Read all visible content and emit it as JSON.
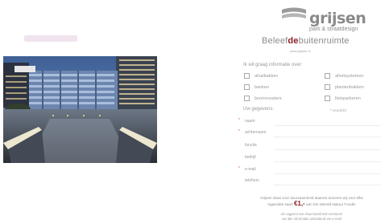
{
  "brand": {
    "name": "grijsen",
    "tagline": "park & straatdesign",
    "slogan_pre": "Beleef",
    "slogan_accent": "de",
    "slogan_post": "buitenruimte",
    "website": "www.grijsen.nl"
  },
  "form": {
    "title": "Ik wil graag informatie over:",
    "options": [
      {
        "label": "afvalbakken",
        "checked": false
      },
      {
        "label": "afzetsystemen",
        "checked": false
      },
      {
        "label": "banken",
        "checked": false
      },
      {
        "label": "plantenbakken",
        "checked": false
      },
      {
        "label": "boomroosters",
        "checked": false
      },
      {
        "label": "fietsparkeren",
        "checked": false
      }
    ],
    "details_label": "Uw gegevens:",
    "required_star": "*",
    "required_text": "verplicht",
    "fields": [
      {
        "label": "naam",
        "required": "*"
      },
      {
        "label": "achternaam",
        "required": "*"
      },
      {
        "label": "functie",
        "required": ""
      },
      {
        "label": "bedrijf",
        "required": ""
      },
      {
        "label": "e-mail",
        "required": "*"
      },
      {
        "label": "telefoon",
        "required": ""
      }
    ]
  },
  "footer": {
    "line1": "Grijsen staat voor duurzaamheid daarom doneren wij voor elke",
    "line2_pre": "ingevulde kaart",
    "amount": "€1,-",
    "line2_post": "aan het Wereld Natuur Fonds!",
    "line3": "uit oogpunt van duurzaamheid versturen",
    "line4": "we alle informatie uitsluitend via e-mail"
  },
  "colors": {
    "accent": "#8a1f2a",
    "text": "#9a9a9a"
  }
}
